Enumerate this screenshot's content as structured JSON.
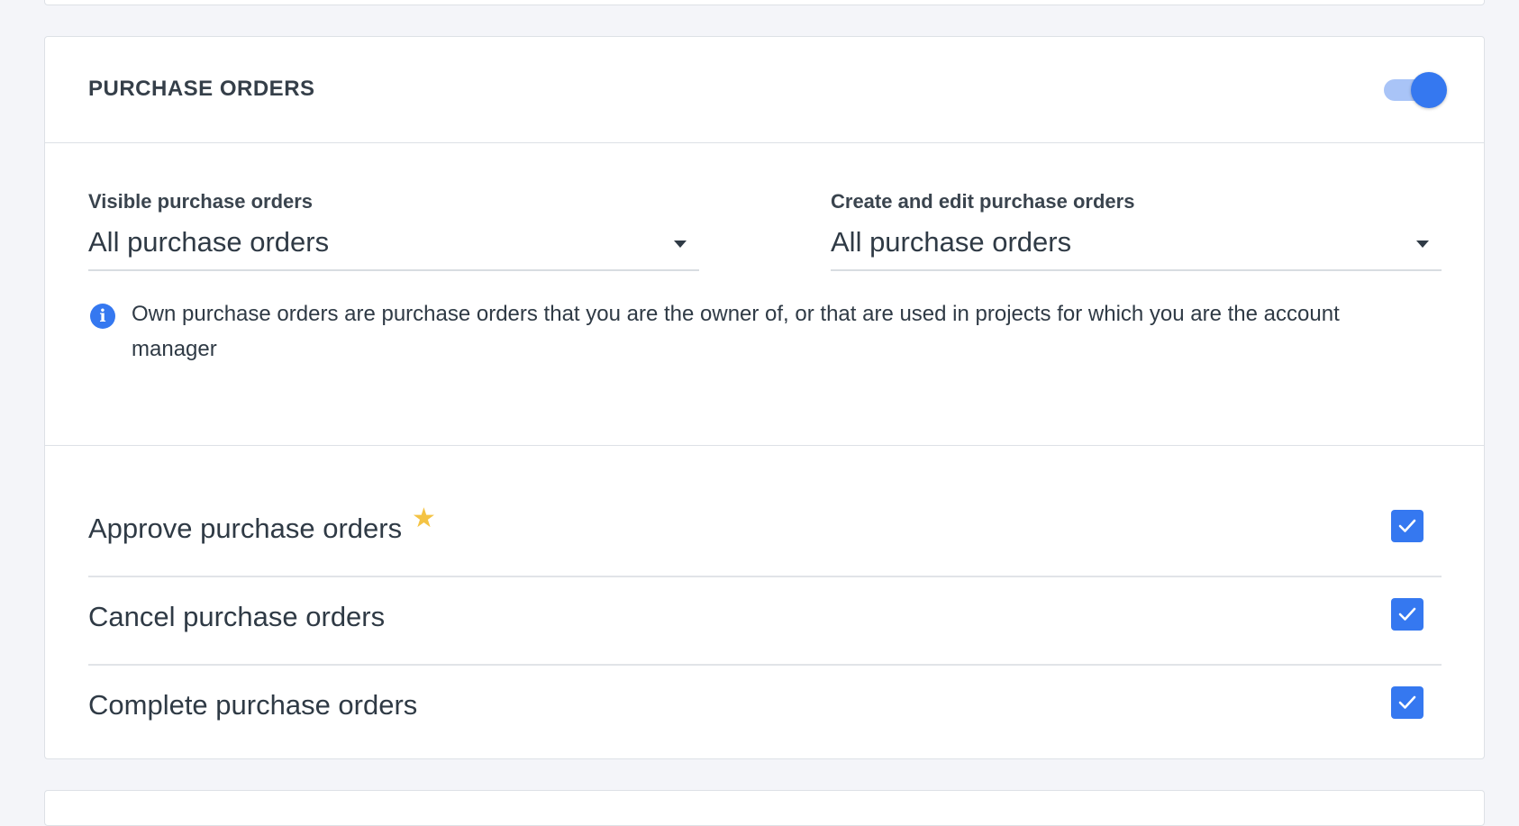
{
  "section": {
    "title": "PURCHASE ORDERS",
    "enabled": true
  },
  "fields": {
    "visible": {
      "label": "Visible purchase orders",
      "value": "All purchase orders"
    },
    "create_edit": {
      "label": "Create and edit purchase orders",
      "value": "All purchase orders"
    },
    "info_text": "Own purchase orders are purchase orders that you are the owner of, or that are used in projects for which you are the account manager"
  },
  "permissions": [
    {
      "label": "Approve purchase orders",
      "checked": true,
      "starred": true
    },
    {
      "label": "Cancel purchase orders",
      "checked": true,
      "starred": false
    },
    {
      "label": "Complete purchase orders",
      "checked": true,
      "starred": false
    }
  ],
  "icons": {
    "info": "info-icon",
    "star": "star-icon",
    "check": "check-icon",
    "caret": "caret-down-icon"
  },
  "colors": {
    "accent": "#3578f0",
    "toggle_track": "#a9c4f7",
    "star": "#f4c344",
    "background": "#f4f5f9"
  }
}
